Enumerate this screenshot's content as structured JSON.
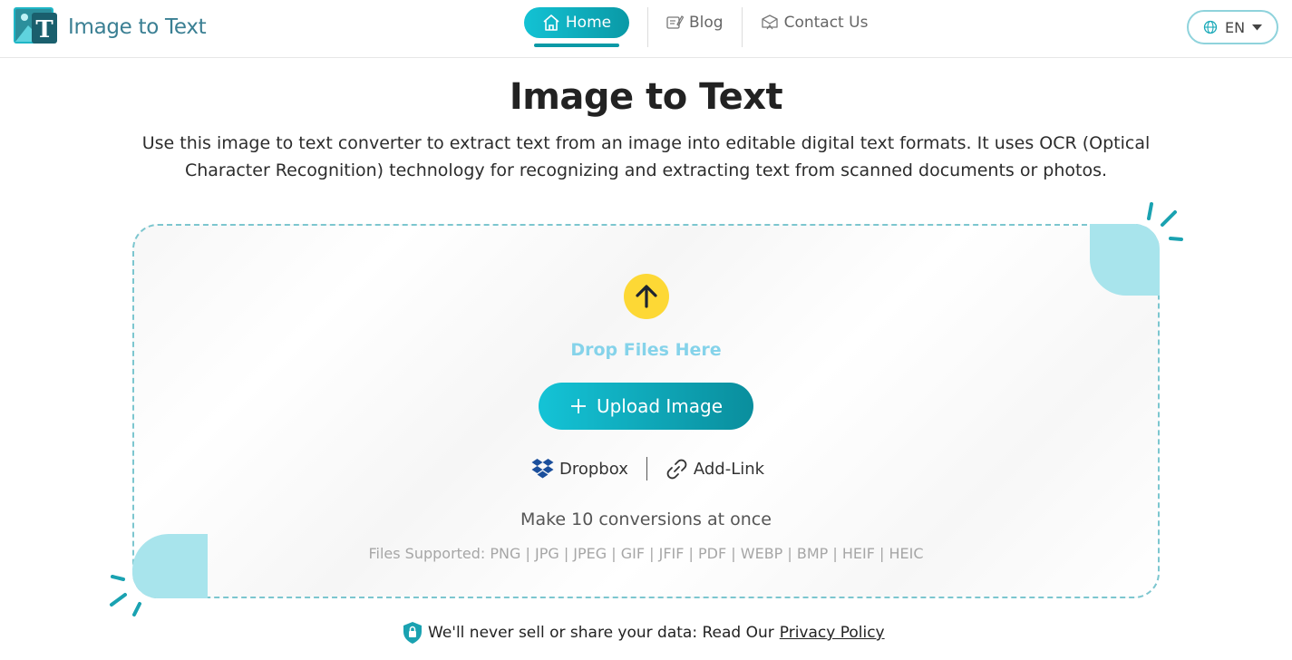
{
  "header": {
    "app_name": "Image to Text",
    "nav": {
      "home": "Home",
      "blog": "Blog",
      "contact": "Contact Us"
    },
    "language": "EN"
  },
  "hero": {
    "title": "Image to Text",
    "description": "Use this image to text converter to extract text from an image into editable digital text formats. It uses OCR (Optical Character Recognition) technology for recognizing and extracting text from scanned documents or photos."
  },
  "dropzone": {
    "drop_label": "Drop Files Here",
    "upload_label": "Upload Image",
    "dropbox_label": "Dropbox",
    "link_label": "Add-Link",
    "conversions_text": "Make 10 conversions at once",
    "formats_text": "Files Supported: PNG | JPG | JPEG | GIF | JFIF | PDF | WEBP | BMP | HEIF | HEIC"
  },
  "privacy": {
    "text": "We'll never sell or share your data: Read Our",
    "link": "Privacy Policy"
  },
  "colors": {
    "accent": "#0a99a6",
    "accent_light": "#13c2d4",
    "upload_circle": "#fdd835",
    "corner_fill": "#a8e4ec",
    "drop_text": "#85d3ea"
  },
  "icons": {
    "logo": "image-text-logo-icon",
    "home": "home-icon",
    "blog": "blog-icon",
    "contact": "contact-icon",
    "globe": "globe-icon",
    "caret": "caret-down-icon",
    "upload": "arrow-up-icon",
    "plus": "plus-icon",
    "dropbox": "dropbox-icon",
    "link": "link-icon",
    "shield": "shield-lock-icon"
  }
}
